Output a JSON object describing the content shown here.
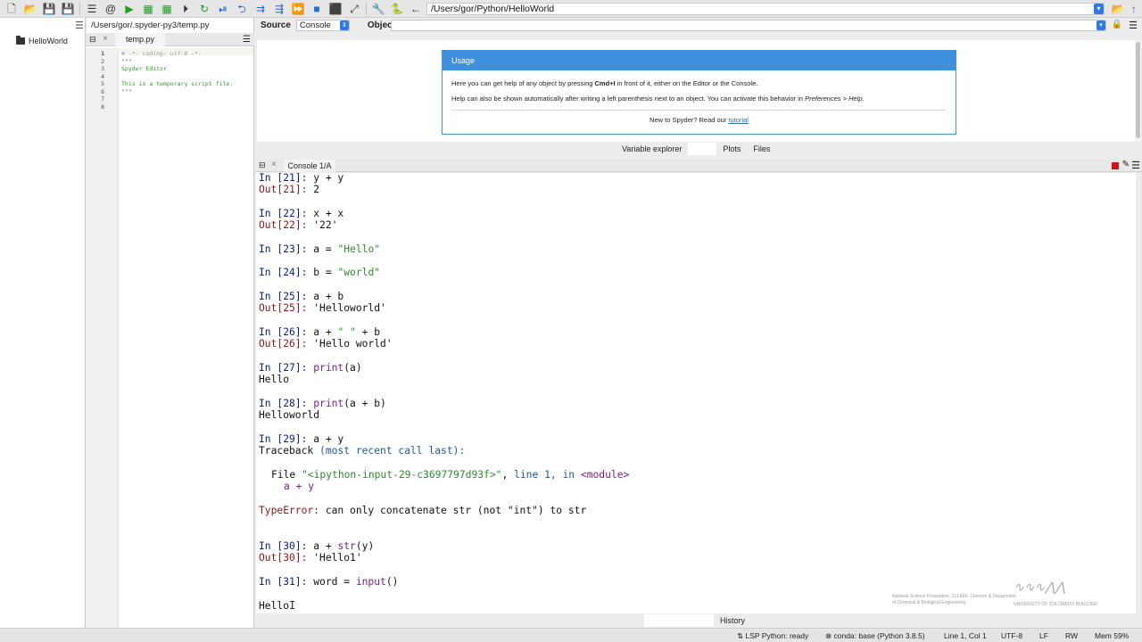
{
  "toolbar": {
    "path": "/Users/gor/Python/HelloWorld"
  },
  "project": {
    "item": "HelloWorld"
  },
  "editor": {
    "file_path": "/Users/gor/.spyder-py3/temp.py",
    "tab": "temp.py",
    "line_numbers": [
      "1",
      "2",
      "3",
      "4",
      "5",
      "6",
      "7",
      "8"
    ],
    "code_lines": [
      "# -*- coding: utf-8 -*-",
      "\"\"\"",
      "Spyder Editor",
      "",
      "This is a temporary script file.",
      "\"\"\"",
      "",
      ""
    ]
  },
  "help": {
    "source_label": "Source",
    "source_value": "Console",
    "object_label": "Object",
    "usage_title": "Usage",
    "p1_a": "Here you can get help of any object by pressing ",
    "p1_key": "Cmd+I",
    "p1_b": " in front of it, either on the Editor or the Console.",
    "p2_a": "Help can also be shown automatically after writing a left parenthesis next to an object. You can activate this behavior in ",
    "p2_em": "Preferences > Help",
    "p2_b": ".",
    "footer_text": "New to Spyder? Read our ",
    "footer_link": "tutorial",
    "tabs": [
      "Variable explorer",
      "",
      "Plots",
      "Files"
    ]
  },
  "console": {
    "tab": "Console 1/A",
    "bottom_tabs": [
      "",
      "History"
    ],
    "lines": {
      "l01_prompt": "In [21]: ",
      "l01_code": "y + y",
      "l02_prompt": "Out[21]: ",
      "l02_value": "2",
      "l03_prompt": "In [22]: ",
      "l03_code": "x + x",
      "l04_prompt": "Out[22]: ",
      "l04_value": "'22'",
      "l05_prompt": "In [23]: ",
      "l05_code": "a = ",
      "l05_str": "\"Hello\"",
      "l06_prompt": "In [24]: ",
      "l06_code": "b = ",
      "l06_str": "\"world\"",
      "l07_prompt": "In [25]: ",
      "l07_code": "a + b",
      "l08_prompt": "Out[25]: ",
      "l08_value": "'Helloworld'",
      "l09_prompt": "In [26]: ",
      "l09_code_a": "a + ",
      "l09_str": "\" \"",
      "l09_code_b": " + b",
      "l10_prompt": "Out[26]: ",
      "l10_value": "'Hello world'",
      "l11_prompt": "In [27]: ",
      "l11_fn": "print",
      "l11_args": "(a)",
      "l12_output": "Hello",
      "l13_prompt": "In [28]: ",
      "l13_fn": "print",
      "l13_args": "(a + b)",
      "l14_output": "Helloworld",
      "l15_prompt": "In [29]: ",
      "l15_code": "a + y",
      "l16_tb": "Traceback ",
      "l16_tb_paren": "(most recent call last):",
      "l17_file": "File ",
      "l17_str": "\"<ipython-input-29-c3697797d93f>\"",
      "l17_comma": ", ",
      "l17_line": "line 1",
      "l17_in": ", in ",
      "l17_module": "<module>",
      "l18_code": "a + y",
      "l19_err": "TypeError:",
      "l19_msg": " can only concatenate str (not \"int\") to str",
      "l20_prompt": "In [30]: ",
      "l20_code": "a + ",
      "l20_fn": "str",
      "l20_args": "(y)",
      "l21_prompt": "Out[30]: ",
      "l21_value": "'Hello1'",
      "l22_prompt": "In [31]: ",
      "l22_code": "word = ",
      "l22_fn": "input",
      "l22_args": "()",
      "l23_input": "Hello"
    },
    "watermark_text": "National Science Foundation, CU-EEF, Chevron & Department of Chemical & Biological Engineering",
    "watermark_uni": "UNIVERSITY OF COLORADO BOULDER"
  },
  "status": {
    "lsp": "LSP Python: ready",
    "conda": "conda: base (Python 3.8.5)",
    "position": "Line 1, Col 1",
    "encoding": "UTF-8",
    "eol": "LF",
    "perm": "RW",
    "mem": "Mem 59%"
  }
}
